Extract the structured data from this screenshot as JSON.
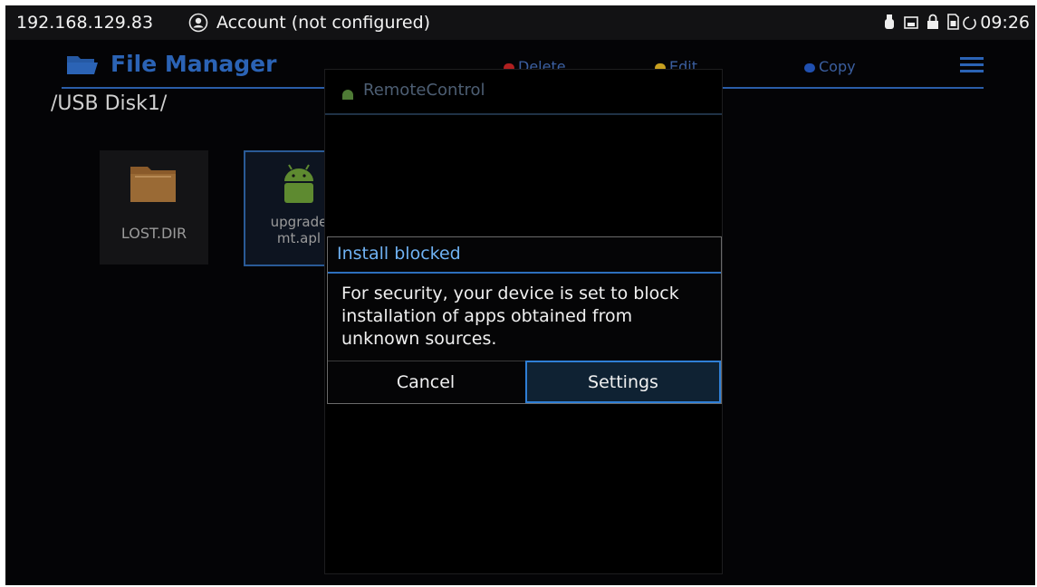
{
  "status_bar": {
    "ip": "192.168.129.83",
    "account": "Account (not configured)",
    "time": "09:26",
    "icons": [
      "avatar-icon",
      "usb-icon",
      "screenshot-icon",
      "lock-icon",
      "sim-icon",
      "sync-icon"
    ]
  },
  "file_manager": {
    "title": "File Manager",
    "actions": {
      "delete": "Delete",
      "edit": "Edit",
      "copy": "Copy"
    },
    "path": "/USB Disk1/",
    "files": [
      {
        "name": "LOST.DIR",
        "type": "folder"
      },
      {
        "name": "upgrade mt.apk",
        "type": "apk",
        "line1": "upgrade",
        "line2": "mt.apl"
      }
    ],
    "colors": {
      "accent": "#2b63b5"
    }
  },
  "remote_window": {
    "title": "RemoteControl"
  },
  "dialog": {
    "title": "Install blocked",
    "message": "For security, your device is set to block installation of apps obtained from unknown sources.",
    "cancel_label": "Cancel",
    "settings_label": "Settings",
    "colors": {
      "title": "#6fb1f2",
      "focus": "#2f7fd6"
    }
  }
}
